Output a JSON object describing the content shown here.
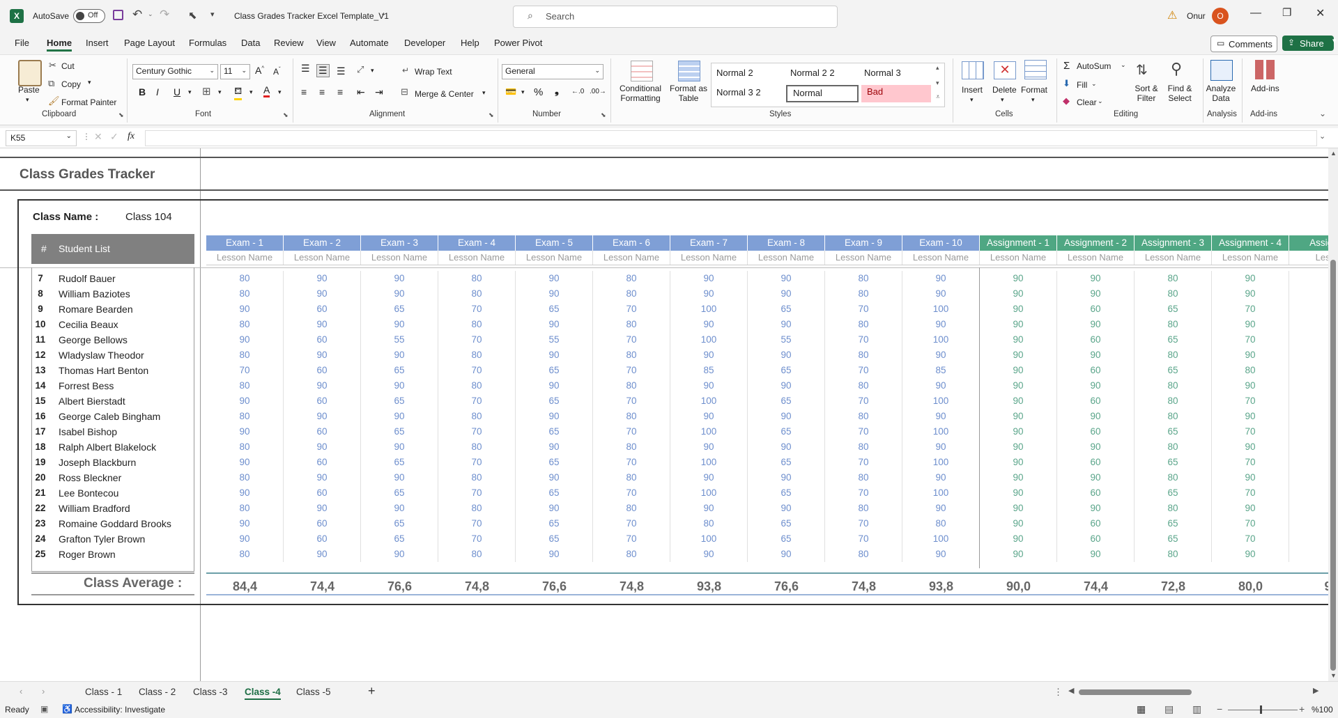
{
  "title_bar": {
    "autosave_label": "AutoSave",
    "autosave_state": "Off",
    "file_name": "Class Grades Tracker Excel Template_V1",
    "search_placeholder": "Search",
    "user_name": "Onur",
    "user_initial": "O"
  },
  "menu": {
    "items": [
      "File",
      "Home",
      "Insert",
      "Page Layout",
      "Formulas",
      "Data",
      "Review",
      "View",
      "Automate",
      "Developer",
      "Help",
      "Power Pivot"
    ],
    "comments_label": "Comments",
    "share_label": "Share"
  },
  "ribbon": {
    "clipboard": {
      "paste": "Paste",
      "cut": "Cut",
      "copy": "Copy",
      "format_painter": "Format Painter",
      "group": "Clipboard"
    },
    "font": {
      "name": "Century Gothic",
      "size": "11",
      "group": "Font"
    },
    "alignment": {
      "wrap_text": "Wrap Text",
      "merge_center": "Merge & Center",
      "group": "Alignment"
    },
    "number": {
      "format": "General",
      "group": "Number"
    },
    "styles": {
      "conditional_formatting": "Conditional Formatting",
      "format_as_table": "Format as Table",
      "style_cells": [
        "Normal 2",
        "Normal 2 2",
        "Normal 3",
        "Normal 3 2",
        "Normal",
        "Bad"
      ],
      "group": "Styles"
    },
    "cells": {
      "insert": "Insert",
      "delete": "Delete",
      "format": "Format",
      "group": "Cells"
    },
    "editing": {
      "autosum": "AutoSum",
      "fill": "Fill",
      "clear": "Clear",
      "sort_filter": "Sort & Filter",
      "find_select": "Find & Select",
      "group": "Editing"
    },
    "analysis": {
      "analyze_data": "Analyze Data",
      "group": "Analysis"
    },
    "addins": {
      "addins": "Add-ins",
      "group": "Add-ins"
    }
  },
  "formula_bar": {
    "name_box": "K55",
    "fx": "fx",
    "value": ""
  },
  "sheet": {
    "title": "Class Grades Tracker",
    "class_name_label": "Class Name :",
    "class_name_value": "Class 104",
    "hash_label": "#",
    "student_list_label": "Student List",
    "exam_headers": [
      "Exam - 1",
      "Exam - 2",
      "Exam - 3",
      "Exam - 4",
      "Exam - 5",
      "Exam - 6",
      "Exam - 7",
      "Exam - 8",
      "Exam - 9",
      "Exam - 10"
    ],
    "assignment_headers": [
      "Assignment - 1",
      "Assignment - 2",
      "Assignment - 3",
      "Assignment - 4",
      "Assignm"
    ],
    "lesson_label": "Lesson Name",
    "lesson_partial": "Lesso",
    "rows": [
      {
        "n": "7",
        "name": "Rudolf Bauer",
        "scores": [
          "80",
          "90",
          "90",
          "80",
          "90",
          "80",
          "90",
          "90",
          "80",
          "90",
          "90",
          "90",
          "80",
          "90"
        ]
      },
      {
        "n": "8",
        "name": "William Baziotes",
        "scores": [
          "80",
          "90",
          "90",
          "80",
          "90",
          "80",
          "90",
          "90",
          "80",
          "90",
          "90",
          "90",
          "80",
          "90"
        ]
      },
      {
        "n": "9",
        "name": "Romare Bearden",
        "scores": [
          "90",
          "60",
          "65",
          "70",
          "65",
          "70",
          "100",
          "65",
          "70",
          "100",
          "90",
          "60",
          "65",
          "70"
        ]
      },
      {
        "n": "10",
        "name": "Cecilia Beaux",
        "scores": [
          "80",
          "90",
          "90",
          "80",
          "90",
          "80",
          "90",
          "90",
          "80",
          "90",
          "90",
          "90",
          "80",
          "90"
        ]
      },
      {
        "n": "11",
        "name": "George Bellows",
        "scores": [
          "90",
          "60",
          "55",
          "70",
          "55",
          "70",
          "100",
          "55",
          "70",
          "100",
          "90",
          "60",
          "65",
          "70"
        ]
      },
      {
        "n": "12",
        "name": "Wladyslaw Theodor",
        "scores": [
          "80",
          "90",
          "90",
          "80",
          "90",
          "80",
          "90",
          "90",
          "80",
          "90",
          "90",
          "90",
          "80",
          "90"
        ]
      },
      {
        "n": "13",
        "name": "Thomas Hart Benton",
        "scores": [
          "70",
          "60",
          "65",
          "70",
          "65",
          "70",
          "85",
          "65",
          "70",
          "85",
          "90",
          "60",
          "65",
          "80"
        ]
      },
      {
        "n": "14",
        "name": "Forrest Bess",
        "scores": [
          "80",
          "90",
          "90",
          "80",
          "90",
          "80",
          "90",
          "90",
          "80",
          "90",
          "90",
          "90",
          "80",
          "90"
        ]
      },
      {
        "n": "15",
        "name": "Albert Bierstadt",
        "scores": [
          "90",
          "60",
          "65",
          "70",
          "65",
          "70",
          "100",
          "65",
          "70",
          "100",
          "90",
          "60",
          "80",
          "70"
        ]
      },
      {
        "n": "16",
        "name": "George Caleb Bingham",
        "scores": [
          "80",
          "90",
          "90",
          "80",
          "90",
          "80",
          "90",
          "90",
          "80",
          "90",
          "90",
          "90",
          "80",
          "90"
        ]
      },
      {
        "n": "17",
        "name": "Isabel Bishop",
        "scores": [
          "90",
          "60",
          "65",
          "70",
          "65",
          "70",
          "100",
          "65",
          "70",
          "100",
          "90",
          "60",
          "65",
          "70"
        ]
      },
      {
        "n": "18",
        "name": "Ralph Albert Blakelock",
        "scores": [
          "80",
          "90",
          "90",
          "80",
          "90",
          "80",
          "90",
          "90",
          "80",
          "90",
          "90",
          "90",
          "80",
          "90"
        ]
      },
      {
        "n": "19",
        "name": "Joseph Blackburn",
        "scores": [
          "90",
          "60",
          "65",
          "70",
          "65",
          "70",
          "100",
          "65",
          "70",
          "100",
          "90",
          "60",
          "65",
          "70"
        ]
      },
      {
        "n": "20",
        "name": "Ross Bleckner",
        "scores": [
          "80",
          "90",
          "90",
          "80",
          "90",
          "80",
          "90",
          "90",
          "80",
          "90",
          "90",
          "90",
          "80",
          "90"
        ]
      },
      {
        "n": "21",
        "name": "Lee Bontecou",
        "scores": [
          "90",
          "60",
          "65",
          "70",
          "65",
          "70",
          "100",
          "65",
          "70",
          "100",
          "90",
          "60",
          "65",
          "70"
        ]
      },
      {
        "n": "22",
        "name": "William Bradford",
        "scores": [
          "80",
          "90",
          "90",
          "80",
          "90",
          "80",
          "90",
          "90",
          "80",
          "90",
          "90",
          "90",
          "80",
          "90"
        ]
      },
      {
        "n": "23",
        "name": "Romaine Goddard Brooks",
        "scores": [
          "90",
          "60",
          "65",
          "70",
          "65",
          "70",
          "80",
          "65",
          "70",
          "80",
          "90",
          "60",
          "65",
          "70"
        ]
      },
      {
        "n": "24",
        "name": "Grafton Tyler Brown",
        "scores": [
          "90",
          "60",
          "65",
          "70",
          "65",
          "70",
          "100",
          "65",
          "70",
          "100",
          "90",
          "60",
          "65",
          "70"
        ]
      },
      {
        "n": "25",
        "name": "Roger Brown",
        "scores": [
          "80",
          "90",
          "90",
          "80",
          "90",
          "80",
          "90",
          "90",
          "80",
          "90",
          "90",
          "90",
          "80",
          "90"
        ]
      }
    ],
    "class_average_label": "Class Average :",
    "class_averages": [
      "84,4",
      "74,4",
      "76,6",
      "74,8",
      "76,6",
      "74,8",
      "93,8",
      "76,6",
      "74,8",
      "93,8",
      "90,0",
      "74,4",
      "72,8",
      "80,0",
      "9"
    ]
  },
  "sheet_tabs": {
    "tabs": [
      "Class - 1",
      "Class - 2",
      "Class -3",
      "Class -4",
      "Class -5"
    ],
    "active": "Class -4",
    "add": "+"
  },
  "status_bar": {
    "ready": "Ready",
    "accessibility": "Accessibility: Investigate",
    "zoom": "%100"
  },
  "colors": {
    "exam_header": "#7f9fd6",
    "assignment_header": "#4fa783",
    "student_header": "#808080",
    "excel_green": "#1e7145"
  }
}
